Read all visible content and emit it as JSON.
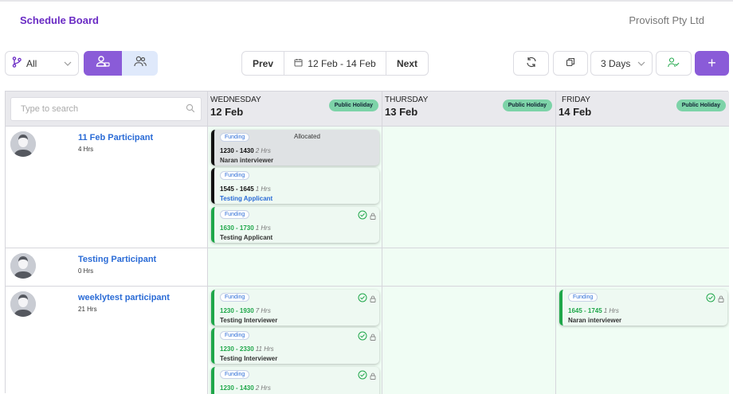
{
  "header": {
    "title": "Schedule Board",
    "company": "Provisoft Pty Ltd"
  },
  "toolbar": {
    "filter_value": "All",
    "prev_label": "Prev",
    "date_range": "12 Feb - 14 Feb",
    "next_label": "Next",
    "view_days": "3 Days",
    "add_label": "+"
  },
  "search": {
    "placeholder": "Type to search"
  },
  "columns": [
    {
      "dow": "WEDNESDAY",
      "date": "12 Feb",
      "badge": "Public Holiday"
    },
    {
      "dow": "THURSDAY",
      "date": "13 Feb",
      "badge": "Public Holiday"
    },
    {
      "dow": "FRIDAY",
      "date": "14 Feb",
      "badge": "Public Holiday"
    }
  ],
  "participants": [
    {
      "name": "11 Feb Participant",
      "hours": "4 Hrs",
      "shifts": [
        {
          "tag": "Funding",
          "status": "Allocated",
          "time": "1230 - 1430",
          "hrs": "2 Hrs",
          "who": "Naran interviewer"
        },
        {
          "tag": "Funding",
          "time": "1545 - 1645",
          "hrs": "1 Hrs",
          "who": "Testing Applicant"
        },
        {
          "tag": "Funding",
          "time": "1630 - 1730",
          "hrs": "1 Hrs",
          "who": "Testing Applicant"
        }
      ]
    },
    {
      "name": "Testing Participant",
      "hours": "0 Hrs"
    },
    {
      "name": "weeklytest participant",
      "hours": "21 Hrs",
      "shifts": [
        {
          "tag": "Funding",
          "time": "1230 - 1930",
          "hrs": "7 Hrs",
          "who": "Testing Interviewer"
        },
        {
          "tag": "Funding",
          "time": "1230 - 2330",
          "hrs": "11 Hrs",
          "who": "Testing Interviewer"
        },
        {
          "tag": "Funding",
          "time": "1230 - 1430",
          "hrs": "2 Hrs"
        }
      ],
      "friday_shifts": [
        {
          "tag": "Funding",
          "time": "1645 - 1745",
          "hrs": "1 Hrs",
          "who": "Naran interviewer"
        }
      ]
    }
  ],
  "colors": {
    "accent": "#8a5bd8",
    "title": "#6a2bc4",
    "confirmed": "#1fa74a",
    "badge": "#7dd3a8",
    "link": "#2a6bd6"
  }
}
